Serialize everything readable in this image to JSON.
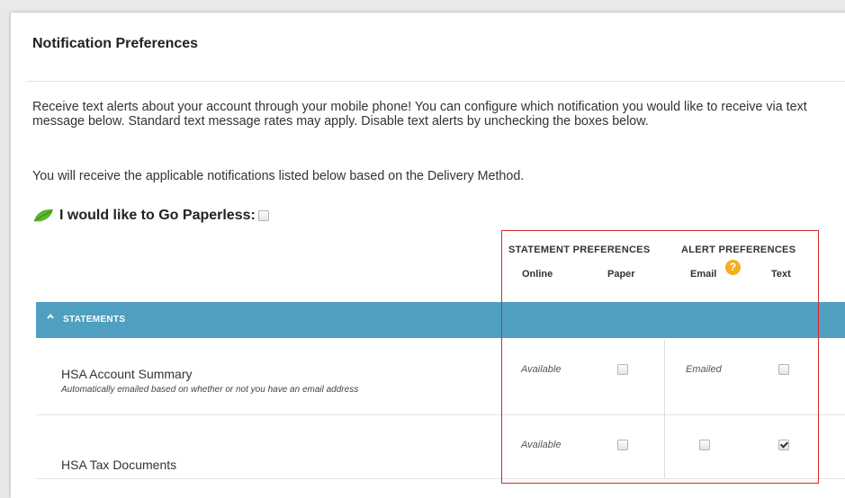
{
  "panel": {
    "title": "Notification Preferences"
  },
  "intro_text": "Receive text alerts about your account through your mobile phone! You can configure which notification you would like to receive via text message below. Standard text message rates may apply. Disable text alerts by unchecking the boxes below.",
  "delivery_text": "You will receive the applicable notifications listed below based on the Delivery Method.",
  "paperless": {
    "label": "I would like to Go Paperless:",
    "checked": false,
    "icon": "leaf-icon"
  },
  "column_groups": {
    "statement": "STATEMENT PREFERENCES",
    "alert": "ALERT PREFERENCES"
  },
  "columns": {
    "online": "Online",
    "paper": "Paper",
    "email": "Email",
    "text": "Text"
  },
  "info_icon": {
    "name": "info-icon",
    "glyph": "?",
    "color": "#f2b01e"
  },
  "section": {
    "label": "STATEMENTS",
    "color": "#4f9fc0",
    "icon": "chevron-up-icon"
  },
  "rows": [
    {
      "title": "HSA Account Summary",
      "subtitle": "Automatically emailed based on whether or not you have an email address",
      "online": "Available",
      "paper_checked": false,
      "email": "Emailed",
      "text_checked": false
    },
    {
      "title": "HSA Tax Documents",
      "subtitle": "",
      "online": "Available",
      "paper_checked": false,
      "email_checked": false,
      "text_checked": true
    }
  ],
  "highlight_color": "#d62a2a"
}
